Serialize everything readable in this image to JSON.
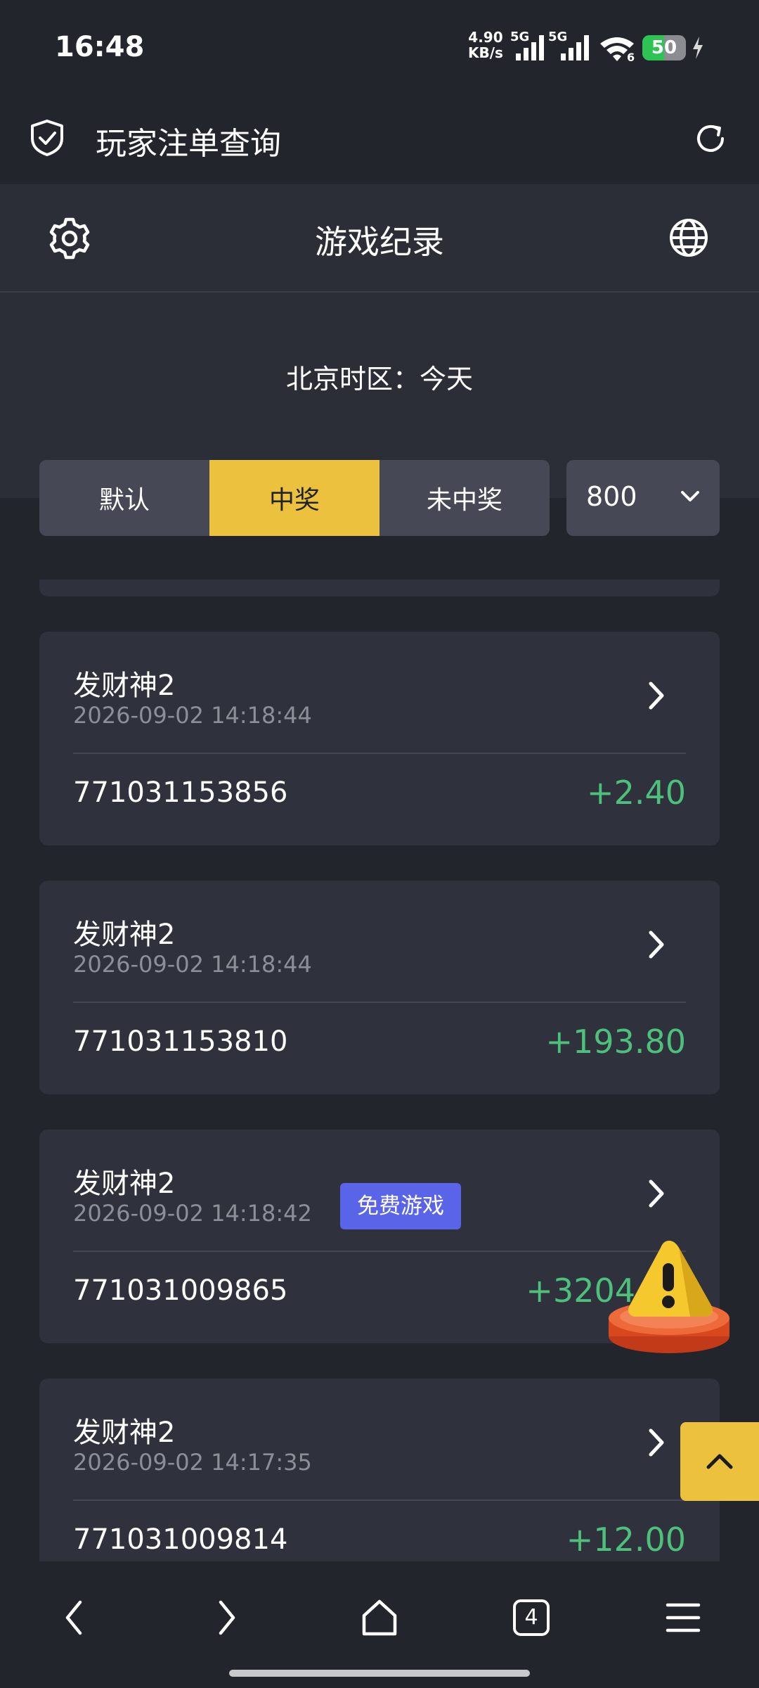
{
  "status_bar": {
    "time": "16:48",
    "net_speed_value": "4.90",
    "net_speed_unit": "KB/s",
    "sim1_label": "5G",
    "sim2_label": "5G",
    "wifi_label": "6",
    "battery": "50",
    "battery_level": 0.5,
    "battery_color": "#2fc353"
  },
  "browser": {
    "title": "玩家注单查询",
    "icons": [
      "shield-check-icon",
      "refresh-icon"
    ]
  },
  "header": {
    "title": "游戏纪录",
    "icons": [
      "settings-icon",
      "globe-icon"
    ]
  },
  "timezone_text": "北京时区：今天",
  "filters": {
    "tabs": [
      {
        "label": "默认",
        "active": false
      },
      {
        "label": "中奖",
        "active": true
      },
      {
        "label": "未中奖",
        "active": false
      }
    ],
    "page_size": "800",
    "accent_color": "#ebc13d"
  },
  "records": [
    {
      "name": "发财神2",
      "time": "2026-09-02 14:18:44",
      "id": "771031153856",
      "amount": "+2.40",
      "badge": ""
    },
    {
      "name": "发财神2",
      "time": "2026-09-02 14:18:44",
      "id": "771031153810",
      "amount": "+193.80",
      "badge": ""
    },
    {
      "name": "发财神2",
      "time": "2026-09-02 14:18:42",
      "id": "771031009865",
      "amount": "+3204",
      "badge": "免费游戏"
    },
    {
      "name": "发财神2",
      "time": "2026-09-02 14:17:35",
      "id": "771031009814",
      "amount": "+12.00",
      "badge": ""
    }
  ],
  "amount_color": "#4dc07c",
  "bottom_nav": {
    "tab_count": "4",
    "icons": [
      "back-icon",
      "forward-icon",
      "home-icon",
      "tabs-icon",
      "menu-icon"
    ]
  }
}
